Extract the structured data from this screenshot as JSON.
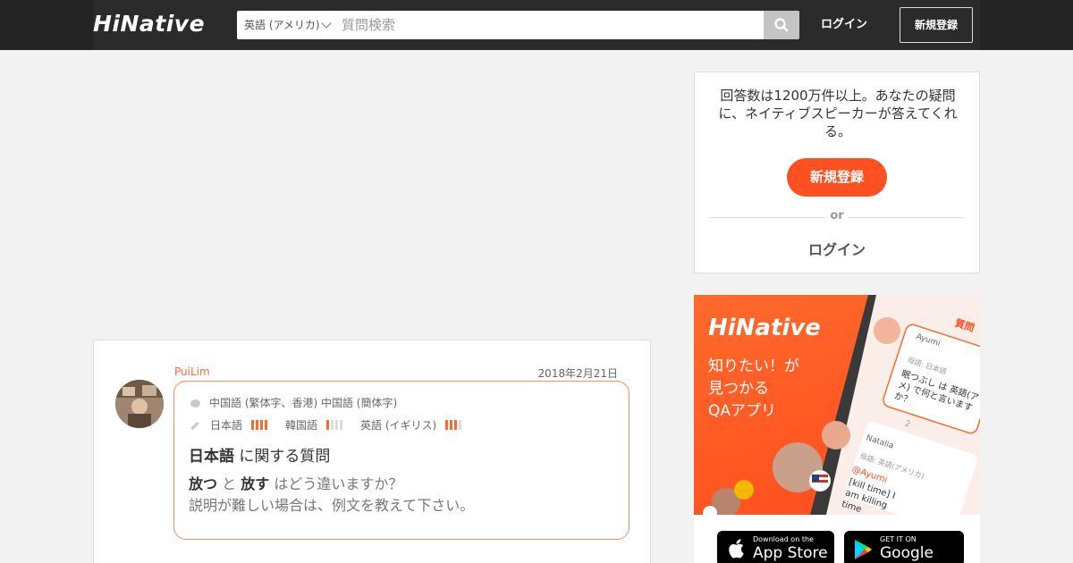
{
  "header": {
    "logo": "HiNative",
    "language_select": "英語 (アメリカ)",
    "search_placeholder": "質問検索",
    "login": "ログイン",
    "signup": "新規登録"
  },
  "sidebar": {
    "register_text": "回答数は1200万件以上。あなたの疑問に、ネイティブスピーカーが答えてくれる。",
    "register_button": "新規登録",
    "or": "or",
    "login": "ログイン"
  },
  "promo": {
    "logo": "HiNative",
    "tagline": [
      "知りたい！が",
      "見つかる",
      "QAアプリ"
    ],
    "phone_label": "質問",
    "user1": "Ayumi",
    "user1_lang": "母語: 日本語",
    "user1_question": "眠つぶし は 英語(アメ) で何と言いますか？",
    "user2": "Natalia",
    "user2_lang": "母語: 英語(アメリカ)",
    "user2_reply_handle": "@Ayumi",
    "user2_reply": "[kill time] I am killing time",
    "likes": "2",
    "app_store_small": "Download on the",
    "app_store_big": "App Store",
    "google_play_small": "GET IT ON",
    "google_play_big": "Google Play"
  },
  "question": {
    "username": "PuiLim",
    "date": "2018年2月21日",
    "native_languages": "中国語 (繁体字、香港)   中国語 (簡体字)",
    "learning": [
      {
        "name": "日本語",
        "level": 4
      },
      {
        "name": "韓国語",
        "level": 1
      },
      {
        "name": "英語 (イギリス)",
        "level": 3
      }
    ],
    "title_lang": "日本語",
    "title_suffix": "に関する質問",
    "word1": "放つ",
    "connector": "と",
    "word2": "放す",
    "body_suffix": "はどう違いますか？",
    "body_line2": "説明が難しい場合は、例文を教えて下さい。"
  },
  "colors": {
    "accent": "#ff5022",
    "header_bg": "#242424",
    "level_on": "#ff6a2c",
    "level_off": "#dcdcdc"
  }
}
